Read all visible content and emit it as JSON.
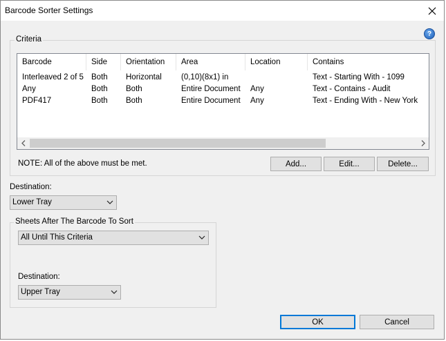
{
  "window": {
    "title": "Barcode Sorter Settings"
  },
  "criteria": {
    "group_label": "Criteria",
    "columns": [
      "Barcode",
      "Side",
      "Orientation",
      "Area",
      "Location",
      "Contains"
    ],
    "rows": [
      [
        "Interleaved 2 of 5",
        "Both",
        "Horizontal",
        "(0,10)(8x1) in",
        "",
        "Text - Starting With - 1099"
      ],
      [
        "Any",
        "Both",
        "Both",
        "Entire Document",
        "Any",
        "Text - Contains - Audit"
      ],
      [
        "PDF417",
        "Both",
        "Both",
        "Entire Document",
        "Any",
        "Text - Ending With - New York"
      ]
    ],
    "note": "NOTE: All of the above must be met.",
    "add_label": "Add...",
    "edit_label": "Edit...",
    "delete_label": "Delete..."
  },
  "destination": {
    "label": "Destination:",
    "value": "Lower Tray"
  },
  "sheets": {
    "group_label": "Sheets After The Barcode To Sort",
    "value": "All Until This Criteria",
    "destination_label": "Destination:",
    "destination_value": "Upper Tray"
  },
  "footer": {
    "ok_label": "OK",
    "cancel_label": "Cancel"
  },
  "icons": {
    "close": "close-icon",
    "help": "help-icon",
    "dropdown": "chevron-down-icon",
    "scroll_left": "chevron-left-icon",
    "scroll_right": "chevron-right-icon"
  },
  "colors": {
    "window_bg": "#f0f0f0",
    "default_button_border": "#0078d7",
    "help_icon": "#1d5fb8"
  }
}
